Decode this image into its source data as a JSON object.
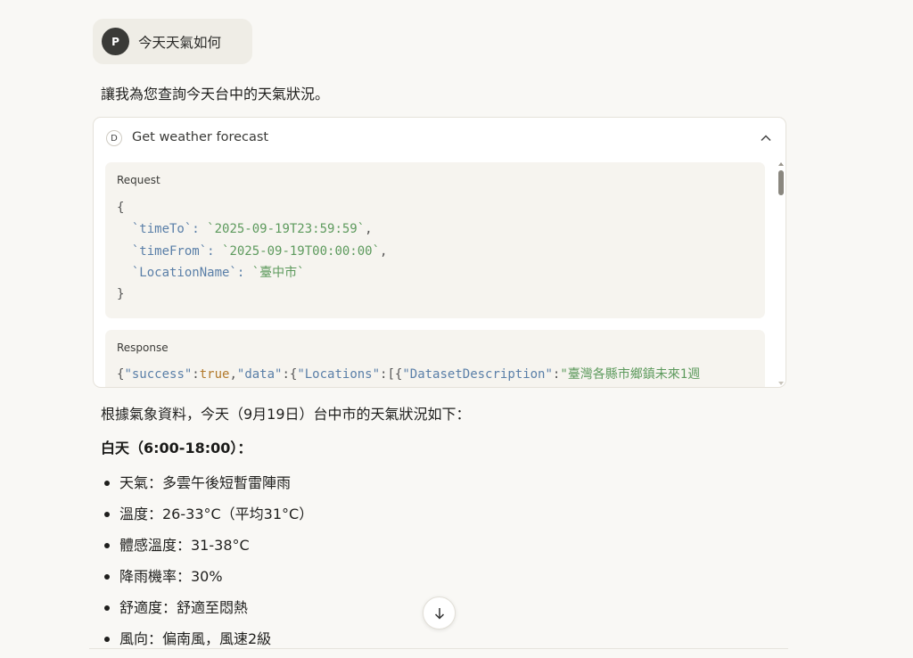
{
  "user_message": {
    "avatar_initial": "P",
    "text": "今天天氣如何"
  },
  "assistant_intro": "讓我為您查詢今天台中的天氣狀況。",
  "tool_call": {
    "badge": "D",
    "title": "Get weather forecast",
    "request_label": "Request",
    "request_lines": [
      [
        {
          "t": "p",
          "v": "{"
        }
      ],
      [
        {
          "t": "p",
          "v": "  "
        },
        {
          "t": "k",
          "v": "`timeTo`"
        },
        {
          "t": "k",
          "v": ": "
        },
        {
          "t": "s",
          "v": "`2025-09-19T23:59:59`"
        },
        {
          "t": "p",
          "v": ","
        }
      ],
      [
        {
          "t": "p",
          "v": "  "
        },
        {
          "t": "k",
          "v": "`timeFrom`"
        },
        {
          "t": "k",
          "v": ": "
        },
        {
          "t": "s",
          "v": "`2025-09-19T00:00:00`"
        },
        {
          "t": "p",
          "v": ","
        }
      ],
      [
        {
          "t": "p",
          "v": "  "
        },
        {
          "t": "k",
          "v": "`LocationName`"
        },
        {
          "t": "k",
          "v": ": "
        },
        {
          "t": "s",
          "v": "`臺中市`"
        }
      ],
      [
        {
          "t": "p",
          "v": "}"
        }
      ]
    ],
    "response_label": "Response",
    "response_lines": [
      [
        {
          "t": "p",
          "v": "{"
        },
        {
          "t": "k",
          "v": "\"success\""
        },
        {
          "t": "p",
          "v": ":"
        },
        {
          "t": "kw",
          "v": "true"
        },
        {
          "t": "p",
          "v": ","
        },
        {
          "t": "k",
          "v": "\"data\""
        },
        {
          "t": "p",
          "v": ":{"
        },
        {
          "t": "k",
          "v": "\"Locations\""
        },
        {
          "t": "p",
          "v": ":[{"
        },
        {
          "t": "k",
          "v": "\"DatasetDescription\""
        },
        {
          "t": "p",
          "v": ":"
        },
        {
          "t": "s",
          "v": "\"臺灣各縣市鄉鎮未來1週"
        }
      ]
    ]
  },
  "summary": "根據氣象資料，今天（9月19日）台中市的天氣狀況如下：",
  "daytime_title": "白天（6:00-18:00）：",
  "daytime_items": [
    "天氣：多雲午後短暫雷陣雨",
    "溫度：26-33°C（平均31°C）",
    "體感溫度：31-38°C",
    "降雨機率：30%",
    "舒適度：舒適至悶熱",
    "風向：偏南風，風速2級"
  ],
  "icons": {
    "collapse": "chevron-up-icon",
    "scroll_down": "arrow-down-icon"
  },
  "colors": {
    "json_key": "#5a7fa8",
    "json_string": "#5d9a5d",
    "json_bool": "#b37a2c",
    "background": "#f9f8f5"
  }
}
